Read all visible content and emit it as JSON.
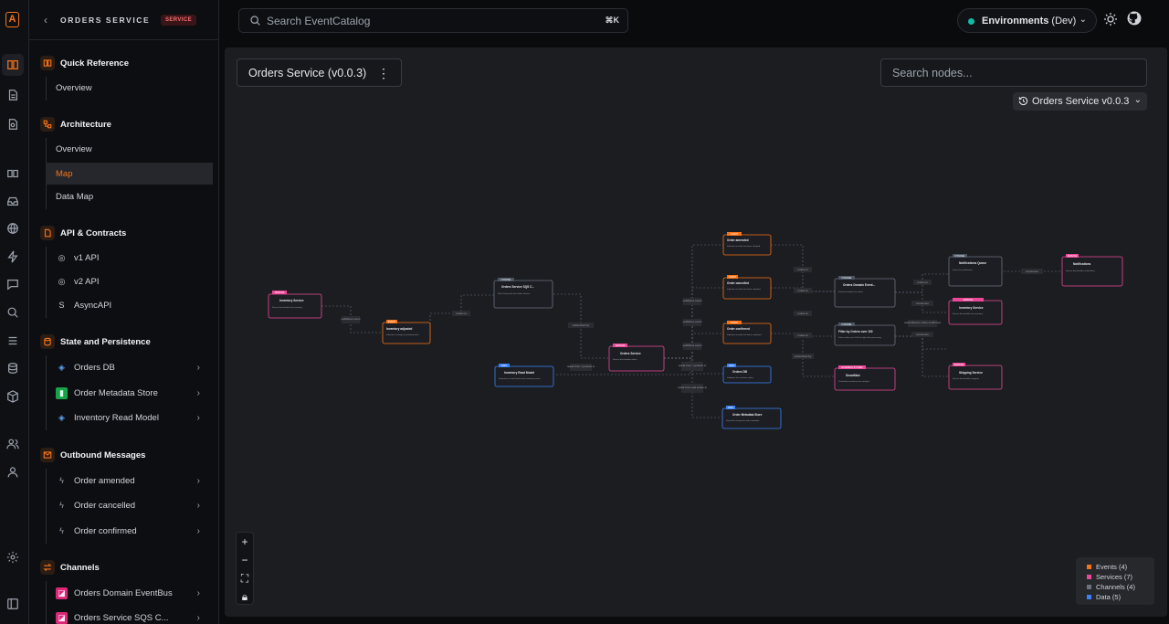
{
  "sidebar": {
    "back_icon": "chevron-left-icon",
    "title": "ORDERS SERVICE",
    "badge": "SERVICE",
    "sections": {
      "quick_reference": {
        "label": "Quick Reference",
        "items": [
          "Overview"
        ]
      },
      "architecture": {
        "label": "Architecture",
        "items": [
          "Overview",
          "Map",
          "Data Map"
        ]
      },
      "api": {
        "label": "API & Contracts",
        "items": [
          "v1 API",
          "v2 API",
          "AsyncAPI"
        ]
      },
      "state": {
        "label": "State and Persistence",
        "items": [
          "Orders DB",
          "Order Metadata Store",
          "Inventory Read Model"
        ]
      },
      "outbound": {
        "label": "Outbound Messages",
        "items": [
          "Order amended",
          "Order cancelled",
          "Order confirmed"
        ]
      },
      "channels": {
        "label": "Channels",
        "items": [
          "Orders Domain EventBus",
          "Orders Service SQS C..."
        ]
      }
    }
  },
  "topbar": {
    "search_placeholder": "Search EventCatalog",
    "search_shortcut": "⌘K",
    "env_label": "Environments",
    "env_value": "(Dev)"
  },
  "canvas": {
    "service_title": "Orders Service (v0.0.3)",
    "node_search_placeholder": "Search nodes...",
    "version_select": "Orders Service v0.0.3"
  },
  "graph": {
    "nodes": {
      "inventory_service_left": {
        "badge": "SERVICE",
        "title": "Inventory Service",
        "version": "(v0.0.3)",
        "desc": "Service that handles the inventory"
      },
      "inventory_adjusted": {
        "badge": "EVENT",
        "title": "Inventory adjusted",
        "version": "(v1.0.1)",
        "desc": "Indicates a change in inventory level"
      },
      "orders_sqs": {
        "badge": "CHANNEL",
        "title": "Orders Service SQS C...",
        "desc": "SQS Channel for the Orders Service"
      },
      "inventory_read_model": {
        "badge": "DATA",
        "title": "Inventory Read Model",
        "version": "(v0.0.1)",
        "desc": "Projection of stock levels from inventory events"
      },
      "orders_service": {
        "badge": "SERVICE",
        "title": "Orders Service",
        "version": "(v0.0.3)",
        "desc": "Service that handles orders"
      },
      "order_amended": {
        "badge": "EVENT",
        "title": "Order amended",
        "version": "(v0.0.1)",
        "desc": "Indicates an order has been changed"
      },
      "order_cancelled": {
        "badge": "EVENT",
        "title": "Order cancelled",
        "version": "(v0.0.1)",
        "desc": "Indicates an order has been canceled"
      },
      "order_confirmed": {
        "badge": "EVENT",
        "title": "Order confirmed",
        "version": "(v0.0.1)",
        "desc": "Indicates an order has been confirmed"
      },
      "orders_db": {
        "badge": "DATA",
        "title": "Orders DB",
        "version": "(v0.0.1)",
        "desc": "Database for customer orders"
      },
      "order_metadata_store": {
        "badge": "DATA",
        "title": "Order Metadata Store",
        "version": "(v0.0.1)",
        "desc": "Key-value storage for order metadata"
      },
      "orders_domain_eventbus": {
        "badge": "CHANNEL",
        "title": "Orders Domain Event...",
        "desc": "Domain eventbus for orders"
      },
      "filter_orders": {
        "badge": "CHANNEL",
        "title": "Filter by Orders over 100",
        "version": "(v0.0.1)",
        "desc": "Filters orders over 100 for high value processing"
      },
      "snowflake": {
        "badge": "EXTERNAL SYSTEM",
        "title": "Snowflake",
        "version": "(v1.0.0)",
        "desc": "Cloud data warehouse for analytics"
      },
      "notifications_queue": {
        "badge": "CHANNEL",
        "title": "Notifications Queue",
        "version": "(v0.0.1)",
        "desc": "Queue for notifications"
      },
      "inventory_service_right": {
        "badge": "SERVICE",
        "title": "Inventory Service",
        "version": "(v0.0.3)",
        "desc": "Service that handles the inventory"
      },
      "shipping_service": {
        "badge": "SERVICE",
        "title": "Shipping Service",
        "version": "(v0.0.1)",
        "desc": "Service that handles shipping"
      },
      "notifications": {
        "badge": "SERVICE",
        "title": "Notifications",
        "version": "(v0.0.2)",
        "desc": "Service that handles notifications"
      }
    },
    "edge_labels": {
      "publishes_event": "publishes event",
      "routes_to": "routes to",
      "subscribed_by": "subscribed by",
      "reads_from_persists": "reads from / persists to",
      "reads_from_writes": "reads from and writes to",
      "subscribed_to_order_confirmed": "subscribed to order confirmed",
      "consumes": "consumes"
    }
  },
  "legend": [
    {
      "label": "Events (4)",
      "color": "#f97316"
    },
    {
      "label": "Services (7)",
      "color": "#ec4899"
    },
    {
      "label": "Channels (4)",
      "color": "#6b7280"
    },
    {
      "label": "Data (5)",
      "color": "#3b82f6"
    }
  ],
  "zoom_controls": [
    "plus-icon",
    "minus-icon",
    "fit-view-icon",
    "lock-icon"
  ]
}
